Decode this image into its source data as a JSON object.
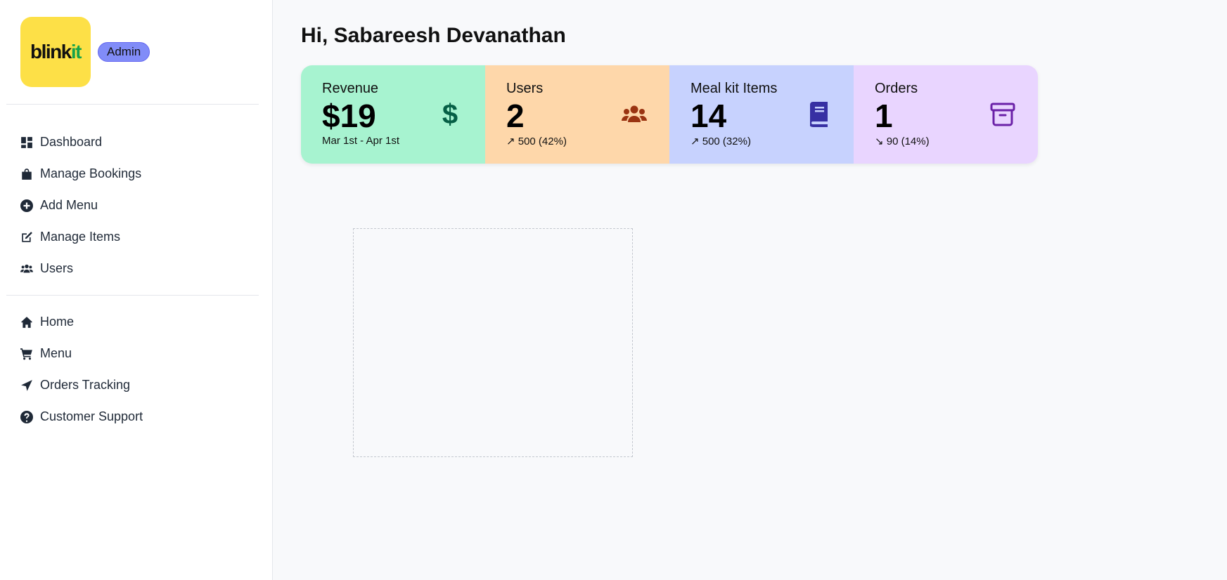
{
  "brand": {
    "logo_part1": "blink",
    "logo_part2": "it",
    "role_badge": "Admin"
  },
  "sidebar": {
    "admin_items": [
      {
        "label": "Dashboard",
        "icon": "dashboard-icon"
      },
      {
        "label": "Manage Bookings",
        "icon": "shopping-bag-icon"
      },
      {
        "label": "Add Menu",
        "icon": "plus-circle-icon"
      },
      {
        "label": "Manage Items",
        "icon": "edit-icon"
      },
      {
        "label": "Users",
        "icon": "users-icon"
      }
    ],
    "site_items": [
      {
        "label": "Home",
        "icon": "home-icon"
      },
      {
        "label": "Menu",
        "icon": "cart-icon"
      },
      {
        "label": "Orders Tracking",
        "icon": "location-arrow-icon"
      },
      {
        "label": "Customer Support",
        "icon": "question-circle-icon"
      }
    ]
  },
  "main": {
    "greeting": "Hi, Sabareesh Devanathan",
    "stats": [
      {
        "label": "Revenue",
        "value": "$19",
        "sub": "Mar 1st - Apr 1st",
        "icon": "dollar-icon",
        "bg": "#a7f3d0",
        "icon_color": "#065f46"
      },
      {
        "label": "Users",
        "value": "2",
        "sub": "↗ 500 (42%)",
        "icon": "users-icon",
        "bg": "#fed7aa",
        "icon_color": "#9a3412"
      },
      {
        "label": "Meal kit Items",
        "value": "14",
        "sub": "↗ 500 (32%)",
        "icon": "book-icon",
        "bg": "#c7d2fe",
        "icon_color": "#3730a3"
      },
      {
        "label": "Orders",
        "value": "1",
        "sub": "↘ 90 (14%)",
        "icon": "archive-icon",
        "bg": "#e9d5ff",
        "icon_color": "#6b21a8"
      }
    ]
  }
}
